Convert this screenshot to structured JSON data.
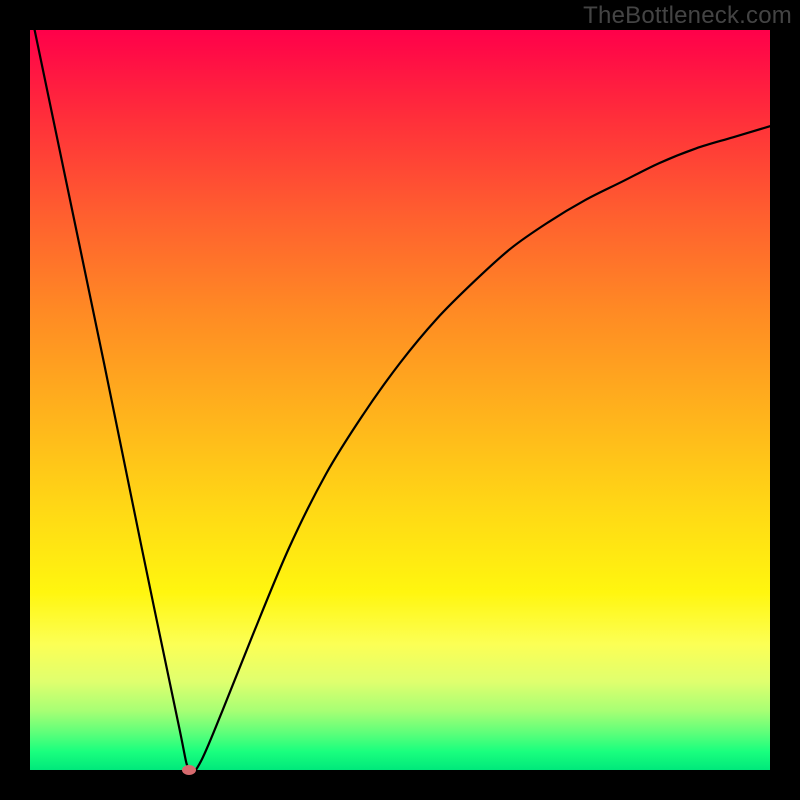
{
  "watermark": "TheBottleneck.com",
  "colors": {
    "frame": "#000000",
    "curve": "#000000",
    "marker": "#d66a6e",
    "gradient_top": "#ff004a",
    "gradient_bottom": "#00e87b"
  },
  "chart_data": {
    "type": "line",
    "title": "",
    "xlabel": "",
    "ylabel": "",
    "xlim": [
      0,
      100
    ],
    "ylim": [
      0,
      100
    ],
    "grid": false,
    "legend": false,
    "series": [
      {
        "name": "bottleneck-curve",
        "x": [
          0,
          5,
          10,
          15,
          20,
          21.5,
          23,
          26,
          30,
          35,
          40,
          45,
          50,
          55,
          60,
          65,
          70,
          75,
          80,
          85,
          90,
          95,
          100
        ],
        "y": [
          103,
          79,
          55,
          30.5,
          6.5,
          0,
          1,
          8,
          18,
          30,
          40,
          48,
          55,
          61,
          66,
          70.5,
          74,
          77,
          79.5,
          82,
          84,
          85.5,
          87
        ]
      }
    ],
    "marker": {
      "x": 21.5,
      "y": 0
    }
  }
}
